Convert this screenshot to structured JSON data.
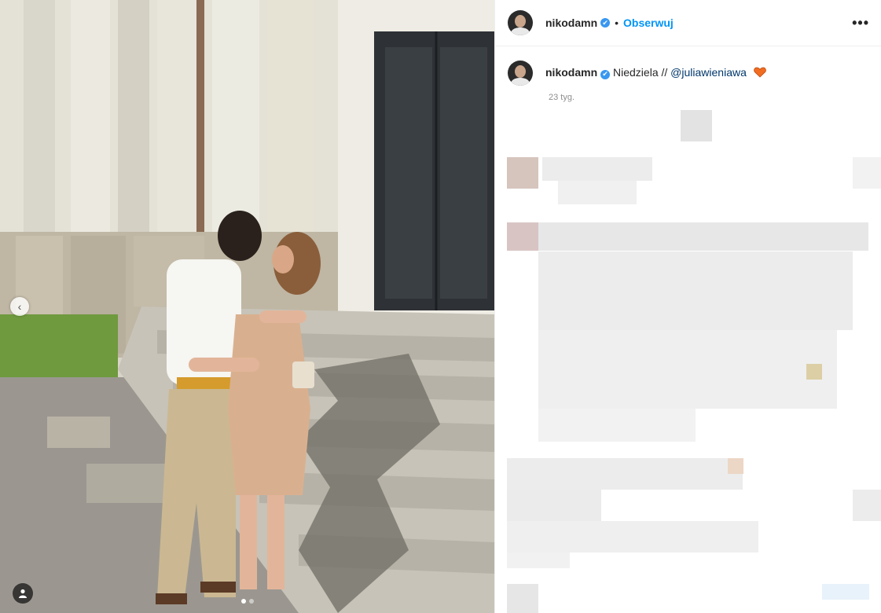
{
  "post": {
    "username": "nikodamn",
    "separator": "•",
    "follow_label": "Obserwuj",
    "more_label": "•••",
    "caption_prefix": "Niedziela // ",
    "mention": "@juliawieniawa",
    "time_ago": "23 tyg."
  },
  "icons": {
    "verified": "✔",
    "prev": "‹",
    "heart_color": "#f26d21",
    "accent": "#0095f6"
  },
  "carousel": {
    "slides": 2,
    "active": 1
  }
}
